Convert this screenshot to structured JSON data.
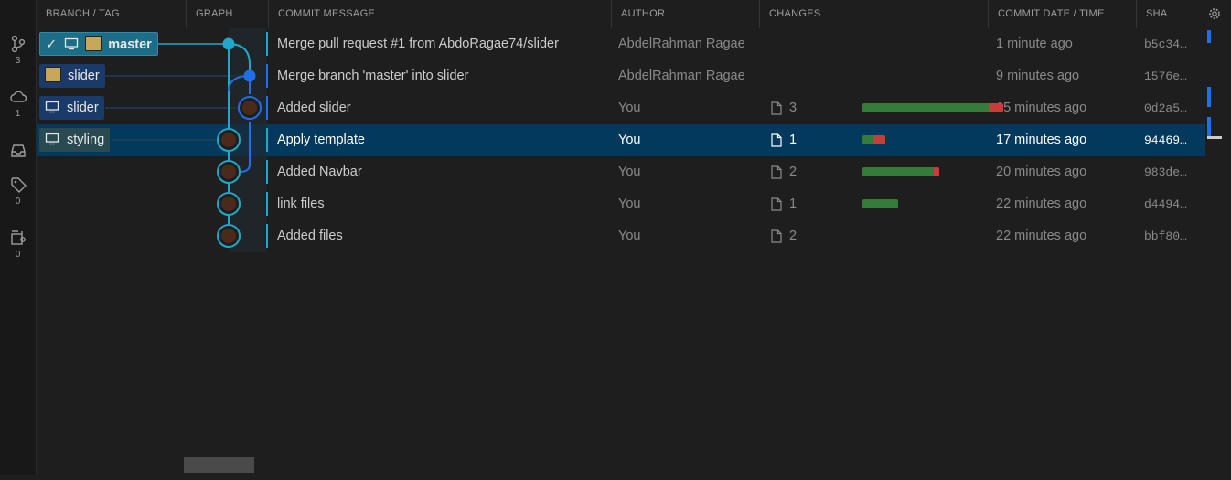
{
  "activity": {
    "items": [
      {
        "icon": "source-control-icon",
        "count": "3"
      },
      {
        "icon": "cloud-icon",
        "count": "1"
      },
      {
        "icon": "inbox-icon",
        "count": ""
      },
      {
        "icon": "tag-icon",
        "count": "0"
      },
      {
        "icon": "worktree-icon",
        "count": "0"
      }
    ]
  },
  "header": {
    "columns": [
      "BRANCH / TAG",
      "GRAPH",
      "COMMIT MESSAGE",
      "AUTHOR",
      "CHANGES",
      "COMMIT DATE / TIME",
      "SHA"
    ]
  },
  "refs": [
    {
      "label": "master",
      "type": "local-current",
      "icons": [
        "check-icon",
        "monitor-icon",
        "avatar-icon"
      ]
    },
    {
      "label": "slider",
      "type": "remote",
      "icons": [
        "avatar-icon"
      ]
    },
    {
      "label": "slider",
      "type": "local",
      "icons": [
        "monitor-icon"
      ]
    },
    {
      "label": "styling",
      "type": "local",
      "icons": [
        "monitor-icon"
      ]
    }
  ],
  "commits": [
    {
      "message": "Merge pull request #1 from AbdoRagae74/slider",
      "author": "AbdelRahman Ragae",
      "changes": "",
      "added": 0,
      "deleted": 0,
      "date": "1 minute ago",
      "sha": "b5c34…"
    },
    {
      "message": "Merge branch 'master' into slider",
      "author": "AbdelRahman Ragae",
      "changes": "",
      "added": 0,
      "deleted": 0,
      "date": "9 minutes ago",
      "sha": "1576e…"
    },
    {
      "message": "Added slider",
      "author": "You",
      "changes": "3",
      "added": 0.9,
      "deleted": 0.1,
      "date": "15 minutes ago",
      "sha": "0d2a5…"
    },
    {
      "message": "Apply template",
      "author": "You",
      "changes": "1",
      "added": 0.09,
      "deleted": 0.08,
      "date": "17 minutes ago",
      "sha": "94469…",
      "selected": true
    },
    {
      "message": "Added Navbar",
      "author": "You",
      "changes": "2",
      "added": 0.51,
      "deleted": 0.04,
      "date": "20 minutes ago",
      "sha": "983de…"
    },
    {
      "message": "link files",
      "author": "You",
      "changes": "1",
      "added": 0.25,
      "deleted": 0,
      "date": "22 minutes ago",
      "sha": "d4494…"
    },
    {
      "message": "Added files",
      "author": "You",
      "changes": "2",
      "added": 0,
      "deleted": 0,
      "date": "22 minutes ago",
      "sha": "bbf80…"
    }
  ],
  "colors": {
    "selected_row": "#04395e",
    "lane_primary": "#1fa8c9",
    "lane_secondary": "#1f6feb",
    "ref_current": "#1d6d86",
    "ref_remote": "#1a3a6a",
    "ref_other": "#2a4a52",
    "bar_add": "#347d39",
    "bar_del": "#c93c37"
  }
}
